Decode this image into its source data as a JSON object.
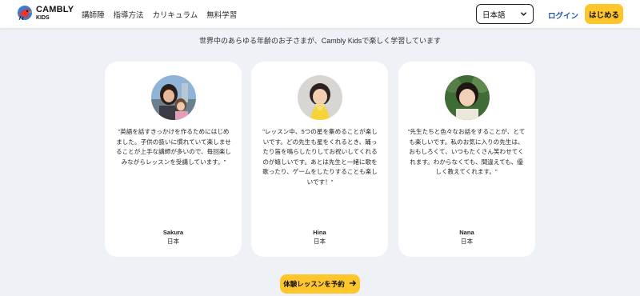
{
  "header": {
    "logo_text": "CAMBLY",
    "logo_sub": "KIDS",
    "nav": [
      "講師陣",
      "指導方法",
      "カリキュラム",
      "無料学習"
    ],
    "language": "日本語",
    "login_label": "ログイン",
    "start_label": "はじめる"
  },
  "section": {
    "subtitle": "世界中のあらゆる年齢のお子さまが、Cambly Kidsで楽しく学習しています"
  },
  "testimonials": [
    {
      "quote": "\"英語を話すきっかけを作るためにはじめました。子供の扱いに慣れていて楽しませることが上手な講師が多いので、毎回楽しみながらレッスンを受講しています。\"",
      "name": "Sakura",
      "country": "日本"
    },
    {
      "quote": "\"レッスン中、5つの星を集めることが楽しいです。どの先生も星をくれるとき、踊ったり笛を鳴らしたりしてお祝いしてくれるのが嬉しいです。あとは先生と一緒に歌を歌ったり、ゲームをしたりすることも楽しいです！\"",
      "name": "Hina",
      "country": "日本"
    },
    {
      "quote": "\"先生たちと色々なお話をすることが、とても楽しいです。私のお気に入りの先生は、おもしろくて、いつもたくさん笑わせてくれます。わからなくても、間違えても、優しく教えてくれます。\"",
      "name": "Nana",
      "country": "日本"
    }
  ],
  "cta": {
    "label": "体験レッスンを予約"
  },
  "colors": {
    "accent": "#ffc62b",
    "link": "#1e55a8",
    "background": "#eef2f7"
  },
  "icons": {
    "language_chevron": "chevron-down-icon",
    "cta_arrow": "arrow-right-icon"
  }
}
